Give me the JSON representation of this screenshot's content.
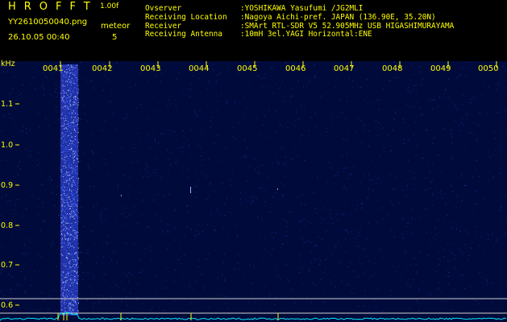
{
  "header": {
    "app_title": "HROFFT",
    "version": "1.00f",
    "filename": "YY2610050040.png",
    "datetime": "26.10.05 00:40",
    "meteor_label": "meteor",
    "meteor_count": "5",
    "info": [
      {
        "key": "Ovserver",
        "value": ":YOSHIKAWA Yasufumi /JG2MLI"
      },
      {
        "key": "Receiving Location",
        "value": ":Nagoya Aichi-pref. JAPAN (136.90E, 35.20N)"
      },
      {
        "key": "Receiver",
        "value": ":SMArt RTL-SDR V5 52.905MHz USB HIGASHIMURAYAMA"
      },
      {
        "key": "Receiving Antenna",
        "value": ":10mH 3el.YAGI Horizontal:ENE"
      }
    ]
  },
  "axis": {
    "unit": "kHz",
    "time_labels": [
      "0041",
      "0042",
      "0043",
      "0044",
      "0045",
      "0046",
      "0047",
      "0048",
      "0049",
      "0050"
    ],
    "freq_labels": [
      "1.1",
      "1.0",
      "0.9",
      "0.8",
      "0.7",
      "0.6"
    ]
  },
  "colors": {
    "text": "#ffff00",
    "background": "#000b3c",
    "signal": "#4a6bff",
    "baseline": "#00e5ff",
    "grid": "#d0d0d0"
  }
}
